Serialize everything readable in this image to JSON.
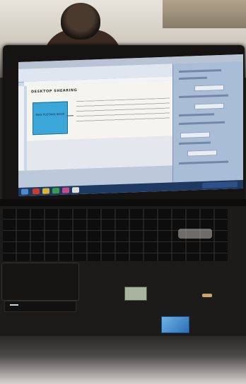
{
  "scene": "laptop on desk displaying a word processor document",
  "document": {
    "heading": "DESKTOP SHEARING",
    "box_label": "MAS PUSTAKA BOOK",
    "paragraph": ""
  },
  "colors": {
    "screen_bg": "#c9d7e8",
    "box_fill": "#3aa7d8",
    "taskbar": "#1e3a63",
    "laptop_body": "#1c1b1a"
  },
  "icons": [
    "nvidia-sticker",
    "intel-sticker",
    "power-button"
  ]
}
